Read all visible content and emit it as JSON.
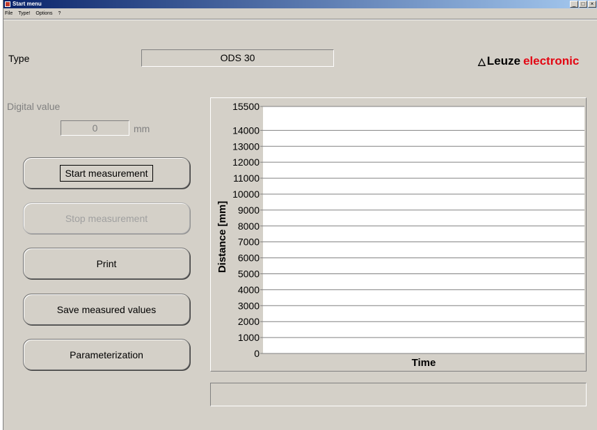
{
  "window": {
    "title": "Start menu",
    "controls": {
      "minimize": "_",
      "maximize": "□",
      "close": "×"
    }
  },
  "menu": {
    "items": [
      "File",
      "Type!",
      "Options",
      "?"
    ]
  },
  "type": {
    "label": "Type",
    "value": "ODS 30"
  },
  "logo": {
    "brand_dark": "Leuze",
    "brand_accent": "electronic",
    "accent_color": "#e30613"
  },
  "digital": {
    "label": "Digital value",
    "value": "0",
    "unit": "mm"
  },
  "buttons": {
    "start": "Start measurement",
    "stop": "Stop measurement",
    "print": "Print",
    "save": "Save measured values",
    "param": "Parameterization"
  },
  "chart_data": {
    "type": "line",
    "xlabel": "Time",
    "ylabel": "Distance [mm]",
    "ylim": [
      0,
      15500
    ],
    "y_ticks": [
      0,
      1000,
      2000,
      3000,
      4000,
      5000,
      6000,
      7000,
      8000,
      9000,
      10000,
      11000,
      12000,
      13000,
      14000,
      15500
    ],
    "grid": true,
    "series": []
  },
  "status": {
    "text": ""
  }
}
